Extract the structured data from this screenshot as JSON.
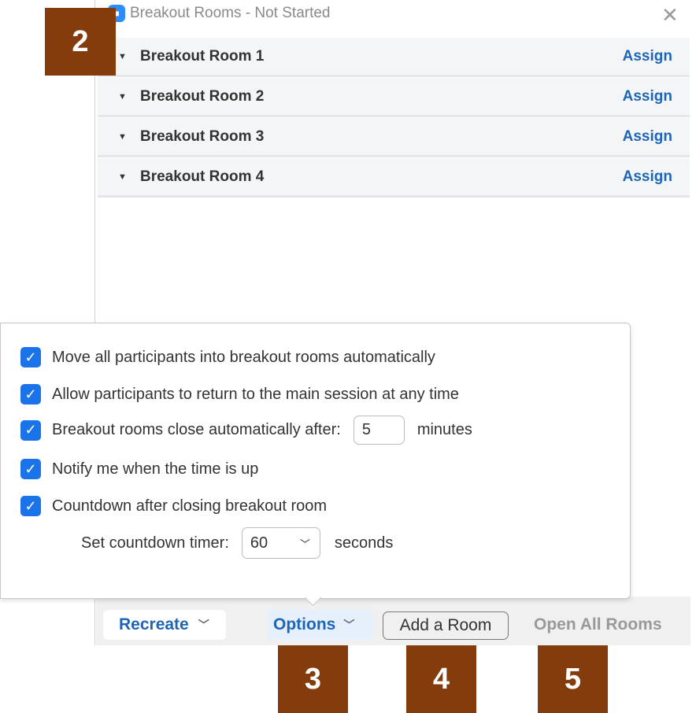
{
  "window": {
    "title": "Breakout Rooms - Not Started",
    "close_icon": "close-icon"
  },
  "rooms": [
    {
      "name": "Breakout Room 1",
      "action": "Assign"
    },
    {
      "name": "Breakout Room 2",
      "action": "Assign"
    },
    {
      "name": "Breakout Room 3",
      "action": "Assign"
    },
    {
      "name": "Breakout Room 4",
      "action": "Assign"
    }
  ],
  "options": {
    "move_auto": {
      "label": "Move all participants into breakout rooms automatically",
      "checked": true
    },
    "allow_return": {
      "label": "Allow participants to return to the main session at any time",
      "checked": true
    },
    "close_auto": {
      "label": "Breakout rooms close automatically after:",
      "value": "5",
      "unit": "minutes",
      "checked": true
    },
    "notify": {
      "label": "Notify me when the time is up",
      "checked": true
    },
    "countdown": {
      "label": "Countdown after closing breakout room",
      "checked": true
    },
    "timer": {
      "label": "Set countdown timer:",
      "value": "60",
      "unit": "seconds"
    }
  },
  "footer": {
    "recreate": "Recreate",
    "options": "Options",
    "add_room": "Add a Room",
    "open_all": "Open All Rooms"
  },
  "badges": [
    "2",
    "3",
    "4",
    "5"
  ],
  "colors": {
    "accent": "#1a73e8",
    "link": "#1e66b5",
    "badge": "#843c0c"
  }
}
